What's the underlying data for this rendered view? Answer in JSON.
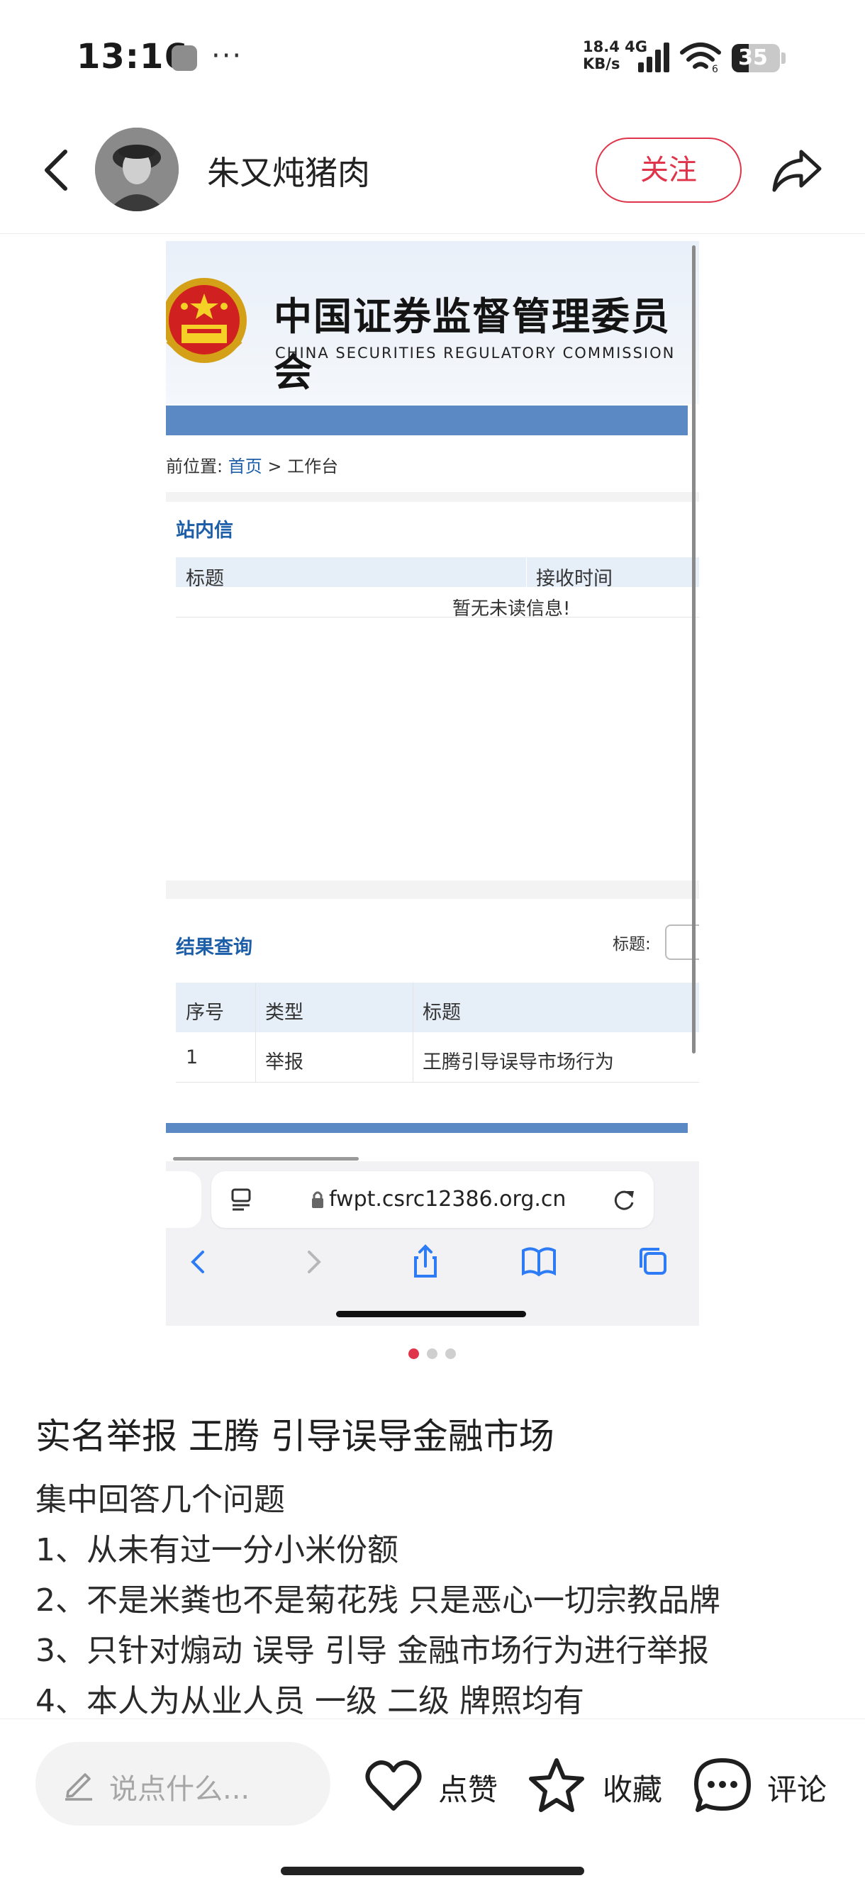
{
  "status_bar": {
    "time": "13:16",
    "more_indicator": "···",
    "net_speed_value": "18.4 4G",
    "net_speed_unit": "KB/s",
    "battery_level": "35",
    "icons": [
      "app-notification-icon",
      "signal-icon",
      "wifi-icon",
      "battery-icon"
    ]
  },
  "header": {
    "author_name": "朱又炖猪肉",
    "follow_label": "关注",
    "icons": [
      "back-arrow-icon",
      "avatar",
      "share-icon"
    ]
  },
  "screenshot": {
    "csrc_title_cn": "中国证券监督管理委员会",
    "csrc_title_en": "CHINA SECURITIES REGULATORY COMMISSION",
    "breadcrumb_prefix": "前位置:",
    "breadcrumb_home": "首页",
    "breadcrumb_sep": " > ",
    "breadcrumb_current": "工作台",
    "inbox": {
      "title": "站内信",
      "columns": [
        "标题",
        "接收时间"
      ],
      "empty_text": "暂无未读信息!"
    },
    "query": {
      "title": "结果查询",
      "filter_label": "标题:",
      "columns": [
        "序号",
        "类型",
        "标题"
      ],
      "rows": [
        {
          "no": "1",
          "type": "举报",
          "title": "王腾引导误导市场行为"
        }
      ]
    },
    "browser": {
      "url": "fwpt.csrc12386.org.cn",
      "icons": [
        "reader-icon",
        "lock-icon",
        "reload-icon",
        "back-icon",
        "forward-icon",
        "share-icon",
        "bookmarks-icon",
        "tabs-icon"
      ]
    }
  },
  "pager": {
    "total": 3,
    "active_index": 0,
    "active_color": "#e0344a"
  },
  "post": {
    "title": "实名举报 王腾 引导误导金融市场",
    "lines": [
      "集中回答几个问题",
      "1、从未有过一分小米份额",
      "2、不是米粪也不是菊花残 只是恶心一切宗教品牌",
      "3、只针对煽动 误导 引导 金融市场行为进行举报",
      "4、本人为从业人员 一级 二级 牌照均有"
    ]
  },
  "bottom_bar": {
    "comment_placeholder": "说点什么...",
    "like_label": "点赞",
    "collect_label": "收藏",
    "comment_label": "评论"
  },
  "colors": {
    "accent": "#e0344a",
    "csrc_blue": "#1d5ea8",
    "nav_blue": "#5a89c4"
  }
}
